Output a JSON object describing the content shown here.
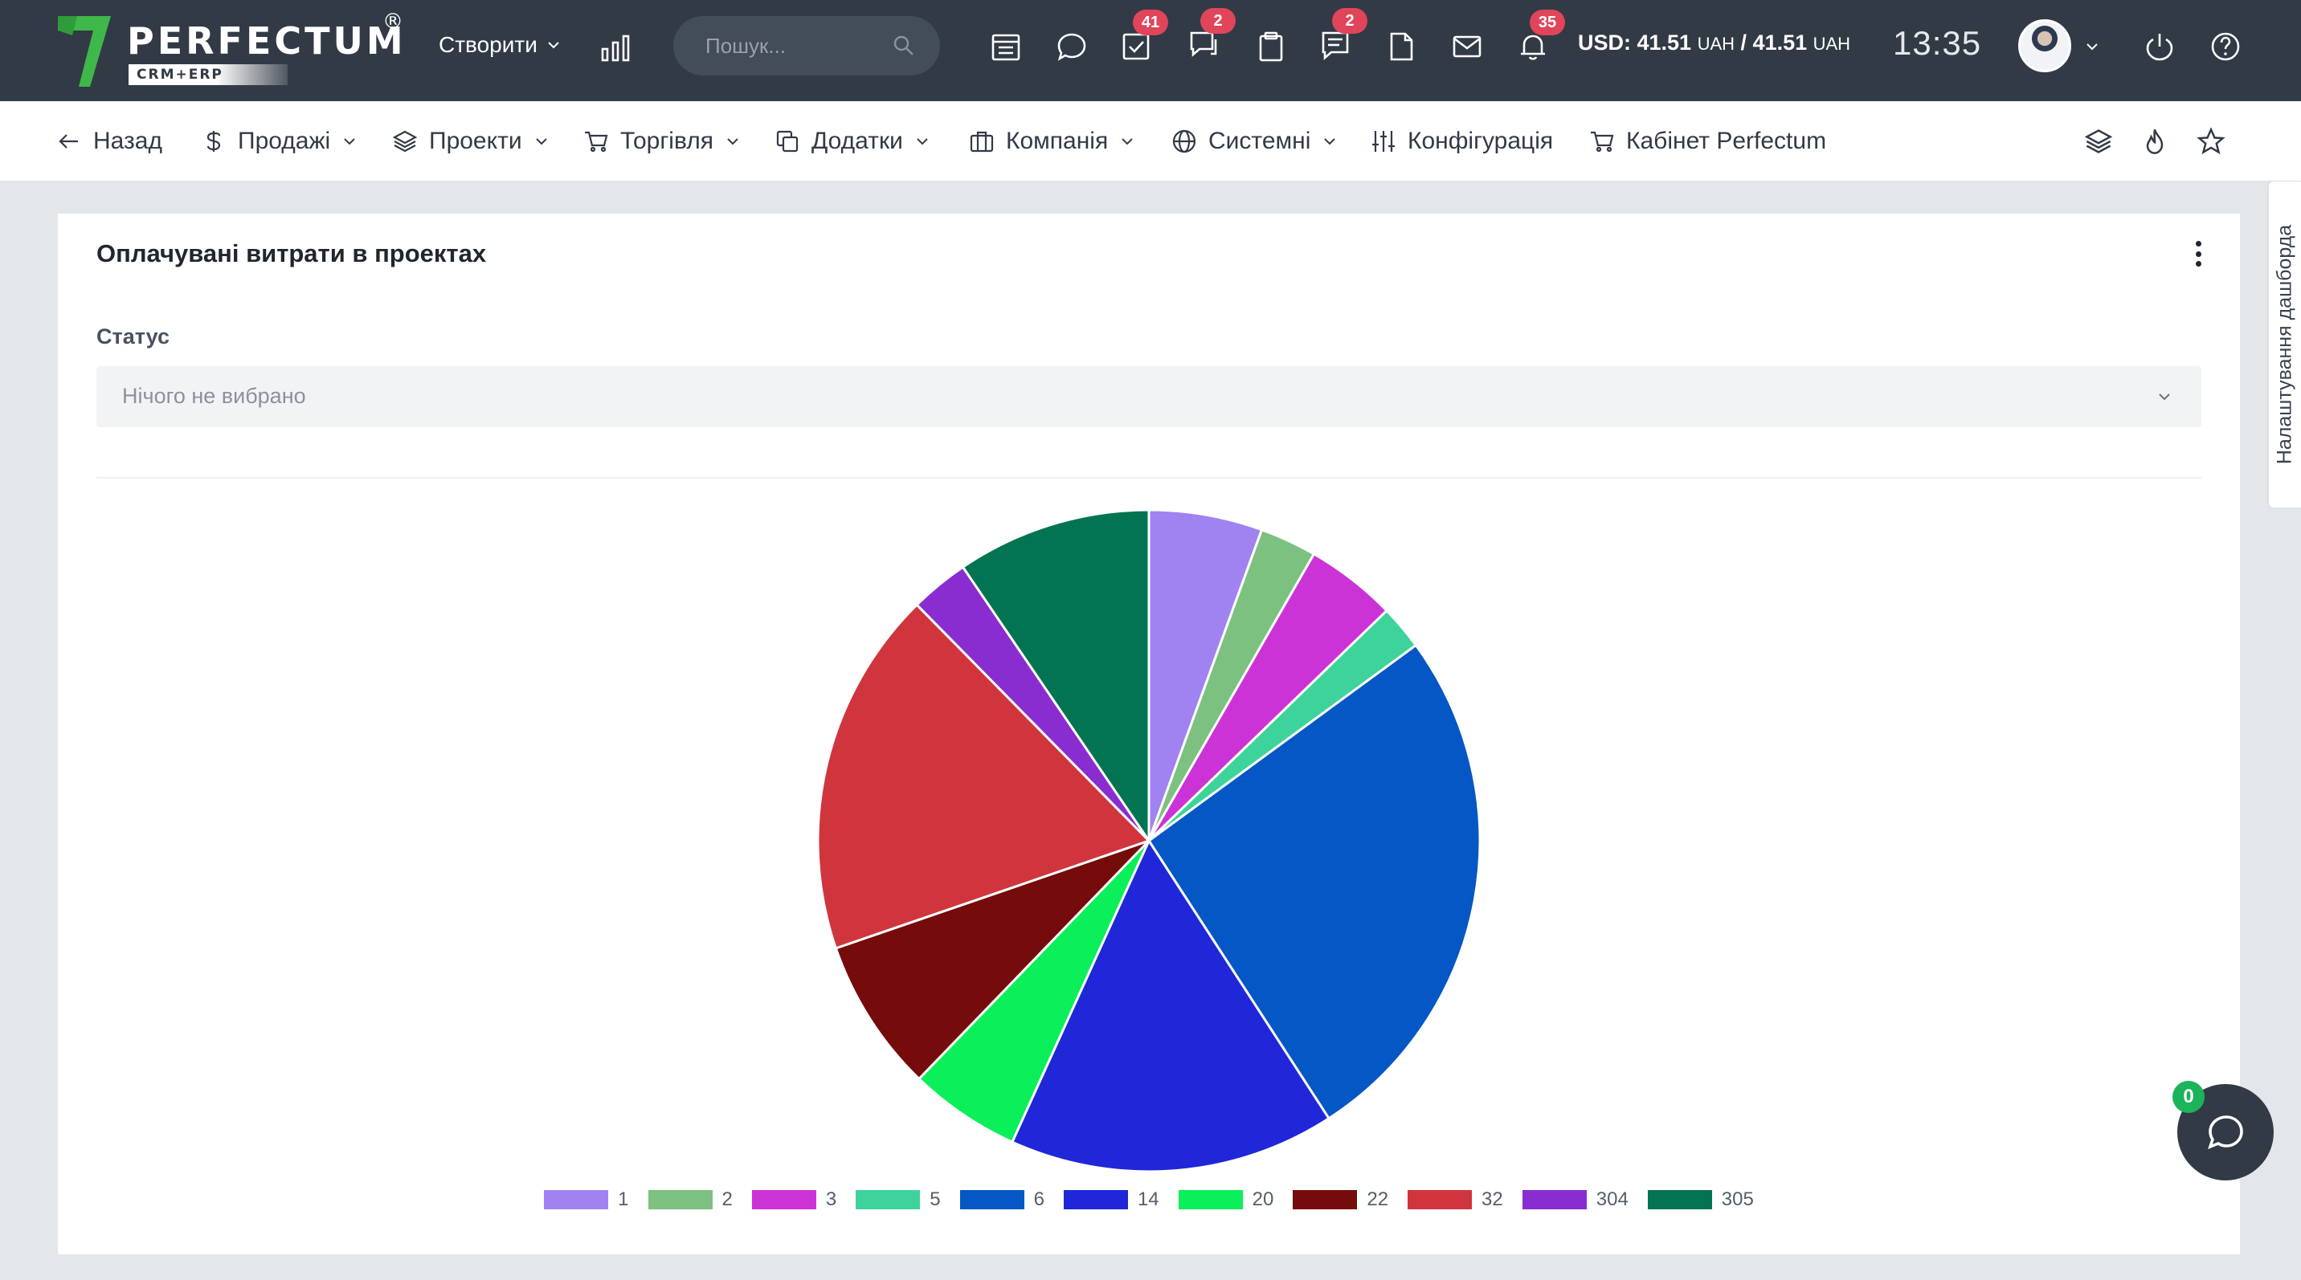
{
  "brand": {
    "name": "PERFECTUM",
    "reg": "®",
    "sub": "CRM+ERP",
    "accent": "#3fb84a"
  },
  "topbar": {
    "create_label": "Створити",
    "search_placeholder": "Пошук...",
    "badges": {
      "tasks": "41",
      "chats": "2",
      "notes": "2",
      "notifications": "35"
    },
    "currency": {
      "usd_label": "USD: 41.51",
      "uah1": "UAH",
      "sep": " / 41.51 ",
      "uah2": "UAH"
    },
    "time": "13:35"
  },
  "nav": {
    "back": "Назад",
    "sales": "Продажі",
    "projects": "Проекти",
    "trade": "Торгівля",
    "addons": "Додатки",
    "company": "Компанія",
    "system": "Системні",
    "config": "Конфігурація",
    "cabinet": "Кабінет Perfectum"
  },
  "side_tab": "Налаштування дашборда",
  "widget": {
    "title": "Оплачувані витрати в проектах",
    "status_label": "Статус",
    "status_placeholder": "Нічого не вибрано"
  },
  "chat": {
    "badge": "0"
  },
  "chart_data": {
    "type": "pie",
    "title": "",
    "categories": [
      "1",
      "2",
      "3",
      "5",
      "6",
      "14",
      "20",
      "22",
      "32",
      "304",
      "305"
    ],
    "values": [
      5.6,
      2.8,
      4.5,
      2.2,
      26.2,
      16.1,
      5.5,
      7.6,
      18.1,
      2.9,
      9.6
    ],
    "colors": [
      "#a083f0",
      "#7cc17f",
      "#cc33d6",
      "#3ed39b",
      "#0457c4",
      "#2027d8",
      "#0aef5a",
      "#760b0b",
      "#d0353d",
      "#8a2dd0",
      "#037451"
    ],
    "legend": "bottom"
  }
}
